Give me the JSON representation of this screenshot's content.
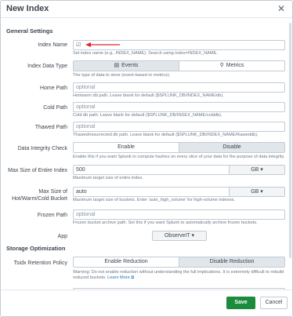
{
  "dialog": {
    "title": "New Index",
    "close_glyph": "✕"
  },
  "sections": {
    "general": "General Settings",
    "storage": "Storage Optimization"
  },
  "fields": {
    "index_name": {
      "label": "Index Name",
      "value": "",
      "help": "Set index name (e.g., INDEX_NAME). Search using index=INDEX_NAME."
    },
    "data_type": {
      "label": "Index Data Type",
      "options": [
        "Events",
        "Metrics"
      ],
      "selected": "Events",
      "help": "The type of data to store (event-based or metrics)."
    },
    "home_path": {
      "label": "Home Path",
      "placeholder": "optional",
      "help": "Hot/warm db path. Leave blank for default ($SPLUNK_DB/INDEX_NAME/db)."
    },
    "cold_path": {
      "label": "Cold Path",
      "placeholder": "optional",
      "help": "Cold db path. Leave blank for default ($SPLUNK_DB/INDEX_NAME/colddb)."
    },
    "thawed_path": {
      "label": "Thawed Path",
      "placeholder": "optional",
      "help": "Thawed/resurrected db path. Leave blank for default ($SPLUNK_DB/INDEX_NAME/thaweddb)."
    },
    "integrity": {
      "label": "Data Integrity Check",
      "options": [
        "Enable",
        "Disable"
      ],
      "selected": "Disable",
      "help": "Enable this if you want Splunk to compute hashes on every slice of your data for the purpose of data integrity."
    },
    "max_index_size": {
      "label": "Max Size of Entire Index",
      "value": "500",
      "unit": "GB ▾",
      "help": "Maximum target size of entire index."
    },
    "max_bucket_size": {
      "label_line1": "Max Size of",
      "label_line2": "Hot/Warm/Cold Bucket",
      "value": "auto",
      "unit": "GB ▾",
      "help": "Maximum target size of buckets. Enter 'auto_high_volume' for high-volume indexes."
    },
    "frozen_path": {
      "label": "Frozen Path",
      "placeholder": "optional",
      "help": "Frozen bucket archive path. Set this if you want Splunk to automatically archive frozen buckets."
    },
    "app": {
      "label": "App",
      "value": "ObserveIT ▾"
    },
    "tsidx": {
      "label": "Tsidx Retention Policy",
      "options": [
        "Enable Reduction",
        "Disable Reduction"
      ],
      "selected": "Disable Reduction",
      "help": "Warning: Do not enable reduction without understanding the full implications. It is extremely difficult to rebuild reduced buckets.",
      "learn_more": "Learn More ⧉"
    }
  },
  "footer": {
    "save": "Save",
    "cancel": "Cancel"
  },
  "icons": {
    "events": "▤",
    "metrics": "🔗"
  },
  "colors": {
    "save": "#1a8c3b",
    "annotation_arrow": "#e0262b"
  }
}
